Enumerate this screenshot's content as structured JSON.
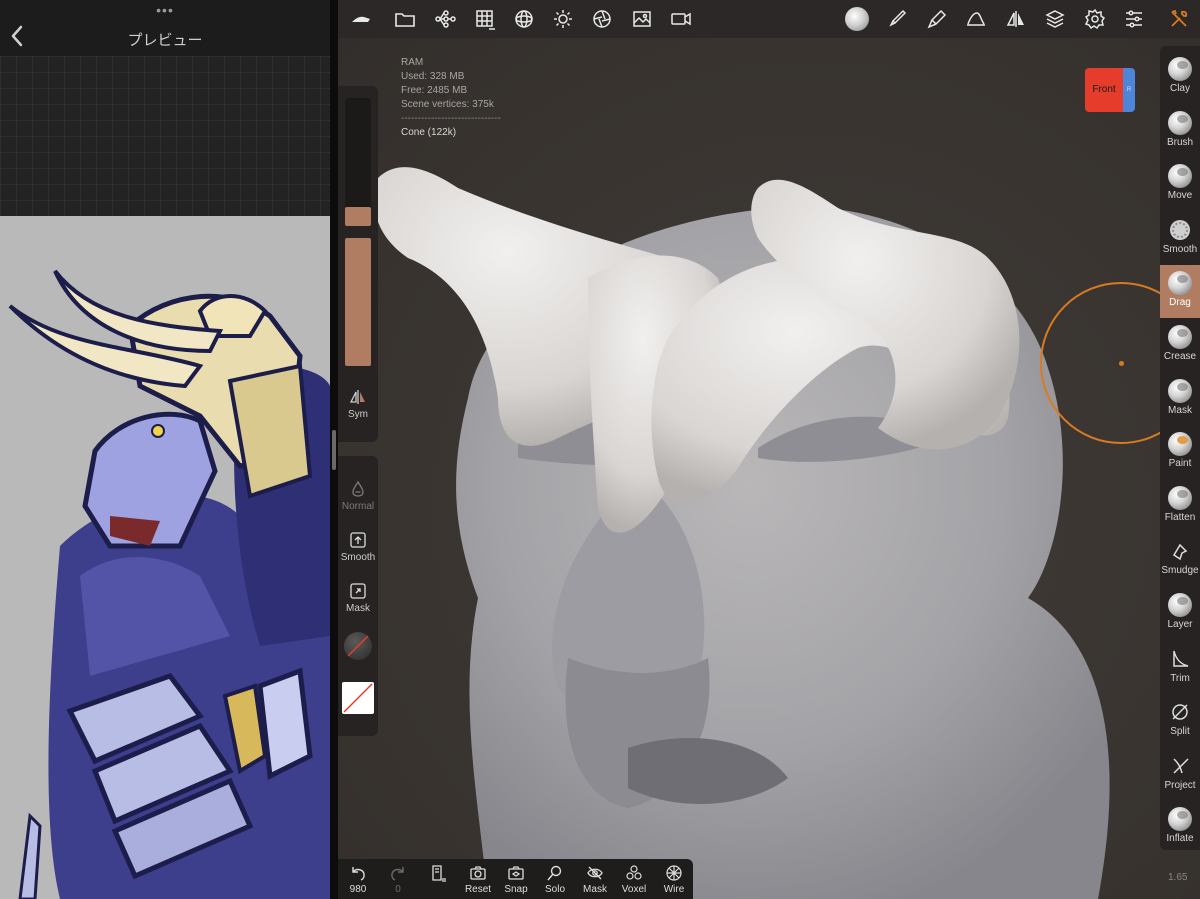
{
  "preview": {
    "title": "プレビュー",
    "more": "•••"
  },
  "stats": {
    "ram_label": "RAM",
    "used": "Used: 328 MB",
    "free": "Free: 2485 MB",
    "vertices": "Scene vertices: 375k",
    "separator": "------------------------------",
    "mesh": "Cone (122k)"
  },
  "gizmo": {
    "front": "Front"
  },
  "left_panel": {
    "sym": "Sym",
    "normal": "Normal",
    "smooth": "Smooth",
    "mask": "Mask",
    "radius_level": 0.15,
    "intensity_level": 1.0
  },
  "tools": [
    {
      "label": "Clay",
      "icon": "clay-icon"
    },
    {
      "label": "Brush",
      "icon": "brush-icon"
    },
    {
      "label": "Move",
      "icon": "move-icon"
    },
    {
      "label": "Smooth",
      "icon": "smooth-icon"
    },
    {
      "label": "Drag",
      "icon": "drag-icon",
      "active": true
    },
    {
      "label": "Crease",
      "icon": "crease-icon"
    },
    {
      "label": "Mask",
      "icon": "mask-icon"
    },
    {
      "label": "Paint",
      "icon": "paint-icon"
    },
    {
      "label": "Flatten",
      "icon": "flatten-icon"
    },
    {
      "label": "Smudge",
      "icon": "smudge-icon"
    },
    {
      "label": "Layer",
      "icon": "layer-icon"
    },
    {
      "label": "Trim",
      "icon": "trim-icon"
    },
    {
      "label": "Split",
      "icon": "split-icon"
    },
    {
      "label": "Project",
      "icon": "project-icon"
    },
    {
      "label": "Inflate",
      "icon": "inflate-icon"
    }
  ],
  "bottom": {
    "undo_count": "980",
    "redo_count": "0",
    "reset": "Reset",
    "snap": "Snap",
    "solo": "Solo",
    "mask": "Mask",
    "voxel": "Voxel",
    "wire": "Wire"
  },
  "version": "1.65",
  "colors": {
    "accent": "#b07d62",
    "cursor": "#d97a22",
    "gizmo_front": "#e53c2c",
    "gizmo_side": "#4d86d8"
  }
}
